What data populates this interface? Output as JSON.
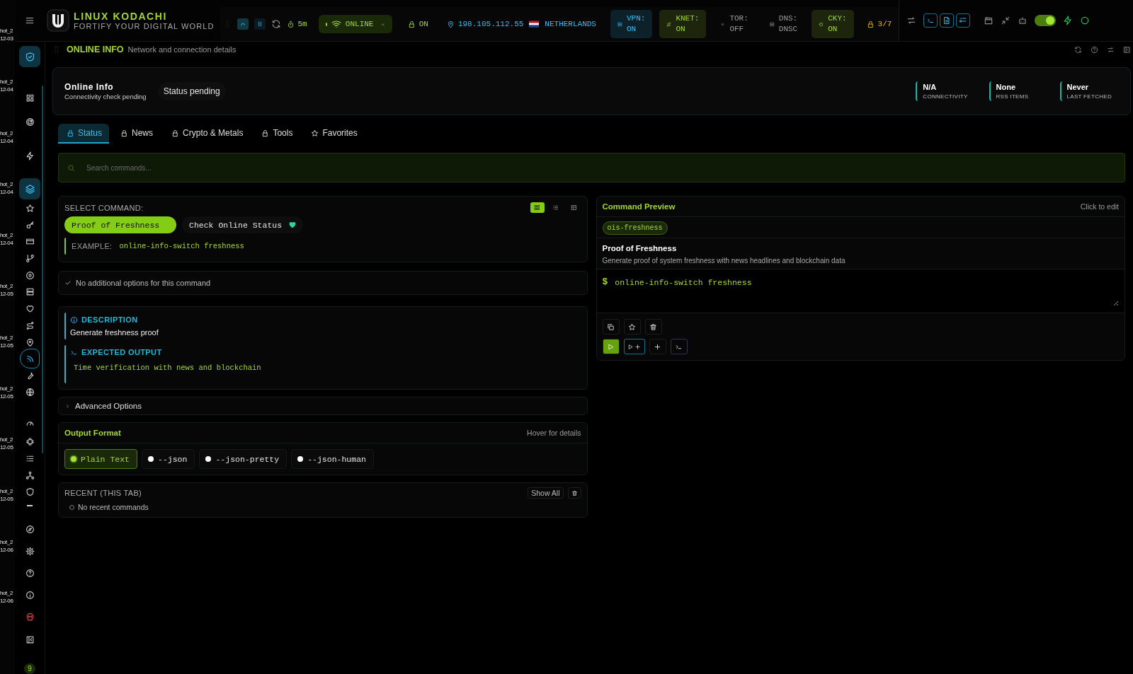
{
  "desktop": {
    "icons": [
      {
        "name": "hot_2",
        "date": "12-03"
      },
      {
        "name": "hot_2",
        "date": "12-04"
      },
      {
        "name": "hot_2",
        "date": "12-04"
      },
      {
        "name": "hot_2",
        "date": "12-04"
      },
      {
        "name": "hot_2",
        "date": "12-04"
      },
      {
        "name": "hot_2",
        "date": "12-05"
      },
      {
        "name": "hot_2",
        "date": "12-05"
      },
      {
        "name": "hot_2",
        "date": "12-05"
      },
      {
        "name": "hot_2",
        "date": "12-05"
      },
      {
        "name": "hot_2",
        "date": "12-05"
      },
      {
        "name": "hot_2",
        "date": "12-06"
      },
      {
        "name": "hot_2",
        "date": "12-06"
      }
    ]
  },
  "header": {
    "title": "LINUX KODACHI",
    "subtitle": "FORTIFY YOUR DIGITAL WORLD"
  },
  "top_bar": {
    "timer": "5m",
    "connection": "ONLINE",
    "lock_status": "ON",
    "ip": "198.105.112.55",
    "country": "NETHERLANDS",
    "chips": [
      {
        "label": "VPN:",
        "value": "ON",
        "color": "#38bdf8",
        "highlighted": true
      },
      {
        "label": "KNET:",
        "value": "ON",
        "color": "#a3d635",
        "highlighted": true
      },
      {
        "label": "TOR:",
        "value": "OFF",
        "color": "#9a9a9a",
        "highlighted": false
      },
      {
        "label": "DNS:",
        "value": "DNSC",
        "color": "#9a9a9a",
        "highlighted": false
      },
      {
        "label": "CKY:",
        "value": "ON",
        "color": "#a3d635",
        "highlighted": true
      }
    ],
    "score": "3/7",
    "power_toggle": {
      "on": true
    }
  },
  "sidebar": {
    "items": [
      {
        "selected": false,
        "highlighted": true
      },
      {
        "selected": false,
        "highlighted": false
      },
      {
        "selected": false,
        "highlighted": false
      },
      {
        "selected": false,
        "highlighted": false
      },
      {
        "selected": false,
        "highlighted": true
      },
      {
        "selected": false,
        "highlighted": false
      },
      {
        "selected": false,
        "highlighted": false
      },
      {
        "selected": false,
        "highlighted": false
      },
      {
        "selected": false,
        "highlighted": false
      },
      {
        "selected": false,
        "highlighted": false
      },
      {
        "selected": false,
        "highlighted": false
      },
      {
        "selected": false,
        "highlighted": false
      },
      {
        "selected": false,
        "highlighted": false
      },
      {
        "selected": false,
        "highlighted": false
      },
      {
        "selected": true,
        "highlighted": false
      },
      {
        "selected": false,
        "highlighted": false
      },
      {
        "selected": false,
        "highlighted": false
      },
      {
        "selected": false,
        "highlighted": false
      },
      {
        "selected": false,
        "highlighted": false
      },
      {
        "selected": false,
        "highlighted": false
      },
      {
        "selected": false,
        "highlighted": false
      },
      {
        "selected": false,
        "highlighted": false
      },
      {
        "selected": false,
        "highlighted": false
      },
      {
        "selected": false,
        "highlighted": false
      },
      {
        "selected": false,
        "highlighted": false
      },
      {
        "selected": false,
        "highlighted": false
      },
      {
        "selected": false,
        "highlighted": false
      },
      {
        "selected": false,
        "highlighted": false
      },
      {
        "selected": false,
        "highlighted": false
      }
    ],
    "badge": "9"
  },
  "section": {
    "title": "ONLINE INFO",
    "subtitle": "Network and connection details"
  },
  "info_card": {
    "title": "Online Info",
    "subtitle": "Connectivity check pending",
    "status": "Status pending",
    "stats": [
      {
        "value": "N/A",
        "label": "CONNECTIVITY"
      },
      {
        "value": "None",
        "label": "RSS ITEMS"
      },
      {
        "value": "Never",
        "label": "LAST FETCHED"
      }
    ]
  },
  "tabs": [
    {
      "label": "Status",
      "kind": "category",
      "selected": true
    },
    {
      "label": "News",
      "kind": "category",
      "selected": false
    },
    {
      "label": "Crypto & Metals",
      "kind": "category",
      "selected": false
    },
    {
      "label": "Tools",
      "kind": "category",
      "selected": false
    },
    {
      "label": "Favorites",
      "kind": "favorites",
      "selected": false
    }
  ],
  "search": {
    "placeholder": "Search commands..."
  },
  "command_select": {
    "label": "SELECT COMMAND:",
    "views": [
      {
        "selected": true
      },
      {
        "selected": false
      },
      {
        "selected": false
      }
    ],
    "commands": [
      {
        "label": "Proof of Freshness",
        "selected": true,
        "favorite": false
      },
      {
        "label": "Check Online Status",
        "selected": false,
        "favorite": true
      }
    ],
    "example_label": "EXAMPLE:",
    "example": "online-info-switch freshness"
  },
  "options_note": "No additional options for this command",
  "details": {
    "description_title": "DESCRIPTION",
    "description": "Generate freshness proof",
    "output_title": "EXPECTED OUTPUT",
    "output": "Time verification with news and blockchain"
  },
  "advanced": {
    "label": "Advanced Options",
    "expanded": false
  },
  "output_format": {
    "title": "Output Format",
    "hint": "Hover for details",
    "options": [
      {
        "label": "Plain Text",
        "selected": true
      },
      {
        "label": "--json",
        "selected": false
      },
      {
        "label": "--json-pretty",
        "selected": false
      },
      {
        "label": "--json-human",
        "selected": false
      }
    ]
  },
  "recent": {
    "title": "RECENT (THIS TAB)",
    "show_all": "Show All",
    "empty": "No recent commands"
  },
  "preview": {
    "title": "Command Preview",
    "hint": "Click to edit",
    "tag": "ois-freshness",
    "name": "Proof of Freshness",
    "description": "Generate proof of system freshness with news headlines and blockchain data",
    "prompt": "$",
    "command": "online-info-switch freshness"
  }
}
